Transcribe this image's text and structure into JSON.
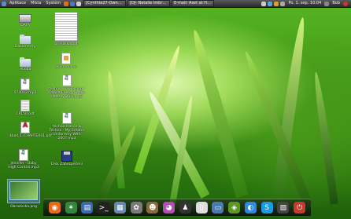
{
  "panel": {
    "menus": [
      "Aplikace",
      "Místa",
      "Systém"
    ],
    "tasks": [
      "[Cynthia27-Ownan]...",
      "[DJ- Natalie Imbruglia ...",
      "E-mail: Aset at Hope ..."
    ],
    "clock": "Po, 1. sep, 10:04",
    "user": "Bob"
  },
  "desktop_icons": [
    {
      "label": "DATA",
      "kind": "drive"
    },
    {
      "label": "Dokumenty",
      "kind": "folder"
    },
    {
      "label": "Hudba",
      "kind": "folder"
    },
    {
      "label": "074002.mp3",
      "kind": "music"
    },
    {
      "label": "CP150.odt",
      "kind": "text"
    },
    {
      "label": "4ball_1_CHAPTER01.pdf",
      "kind": "pdf"
    },
    {
      "label": "Jennifer - Baby High Control.mp3",
      "kind": "music"
    },
    {
      "label": "Obrazovka.png",
      "kind": "thumb"
    }
  ],
  "desktop_icons_col2": [
    {
      "label": "prihlaska.pdf",
      "kind": "bigdoc"
    },
    {
      "label": "ekonom.doc",
      "kind": "img"
    },
    {
      "label": "techno - 7x Techno - Dance Energy & Mix (Mlžsky Bus).mp3",
      "kind": "music"
    },
    {
      "label": "techno trance & Techno - My Creator Uniformity With 2007 mp3",
      "kind": "music"
    },
    {
      "label": "Disk Zabezpečení",
      "kind": "floppy"
    }
  ],
  "dock": {
    "apps": [
      {
        "name": "firefox-icon",
        "glyph": "◉",
        "color": "#e86a1a"
      },
      {
        "name": "network-icon",
        "glyph": "✶",
        "color": "#2e8a3a"
      },
      {
        "name": "libreoffice-icon",
        "glyph": "▤",
        "color": "#3a6ab0"
      },
      {
        "name": "terminal-icon",
        "glyph": ">_",
        "color": "#222"
      },
      {
        "name": "files-icon",
        "glyph": "▦",
        "color": "#6a8ab0"
      },
      {
        "name": "settings-icon",
        "glyph": "✿",
        "color": "#7a7a7a"
      },
      {
        "name": "gimp-icon",
        "glyph": "☻",
        "color": "#8a6a3a"
      },
      {
        "name": "pidgin-icon",
        "glyph": "◕",
        "color": "#b050b0"
      },
      {
        "name": "tux-icon",
        "glyph": "♟",
        "color": "#333"
      },
      {
        "name": "ipod-icon",
        "glyph": "▯",
        "color": "#ddd"
      },
      {
        "name": "monitor-icon",
        "glyph": "▭",
        "color": "#4a7ab0"
      },
      {
        "name": "nvidia-icon",
        "glyph": "◈",
        "color": "#5a9a20"
      },
      {
        "name": "chat-icon",
        "glyph": "◐",
        "color": "#2a8ae0"
      },
      {
        "name": "skype-icon",
        "glyph": "S",
        "color": "#1a9ae0"
      },
      {
        "name": "clapper-icon",
        "glyph": "▧",
        "color": "#444"
      },
      {
        "name": "power-icon",
        "glyph": "⏻",
        "color": "#c83a2a"
      }
    ]
  }
}
